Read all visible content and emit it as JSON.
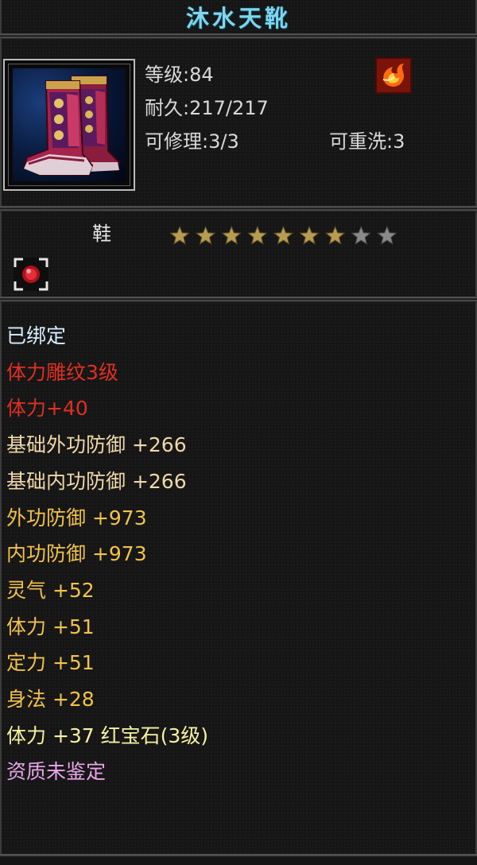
{
  "item": {
    "name": "沐水天靴",
    "icon": "boots-icon",
    "slot": "鞋",
    "stats": {
      "level": "等级:84",
      "durability": "耐久:217/217",
      "repairable": "可修理:3/3",
      "rewash": "可重洗:3"
    },
    "element_icon": "fire-element-icon",
    "stars": {
      "total": 9,
      "filled": 7,
      "filled_color": "#b79c52",
      "empty_color": "#8a8a8a"
    },
    "gem_slot_icon": "ruby-gem-icon"
  },
  "attributes": [
    {
      "text": "已绑定",
      "color": "#d8f0ff"
    },
    {
      "text": "体力雕纹3级",
      "color": "#e03020"
    },
    {
      "text": "体力+40",
      "color": "#e03020"
    },
    {
      "text": "基础外功防御 +266",
      "color": "#f0d8a8"
    },
    {
      "text": "基础内功防御 +266",
      "color": "#f0d8a8"
    },
    {
      "text": "外功防御 +973",
      "color": "#f2c24a"
    },
    {
      "text": "内功防御 +973",
      "color": "#f2c24a"
    },
    {
      "text": "灵气 +52",
      "color": "#f2c24a"
    },
    {
      "text": "体力 +51",
      "color": "#f2c24a"
    },
    {
      "text": "定力 +51",
      "color": "#f2c24a"
    },
    {
      "text": "身法 +28",
      "color": "#f2c24a"
    },
    {
      "text": "体力 +37 红宝石(3级)",
      "color": "#f6f2a0"
    },
    {
      "text": "资质未鉴定",
      "color": "#e8a6e8"
    }
  ],
  "colors": {
    "title": "#7fd6ee",
    "background": "#161616",
    "border": "#6d6d6d"
  }
}
